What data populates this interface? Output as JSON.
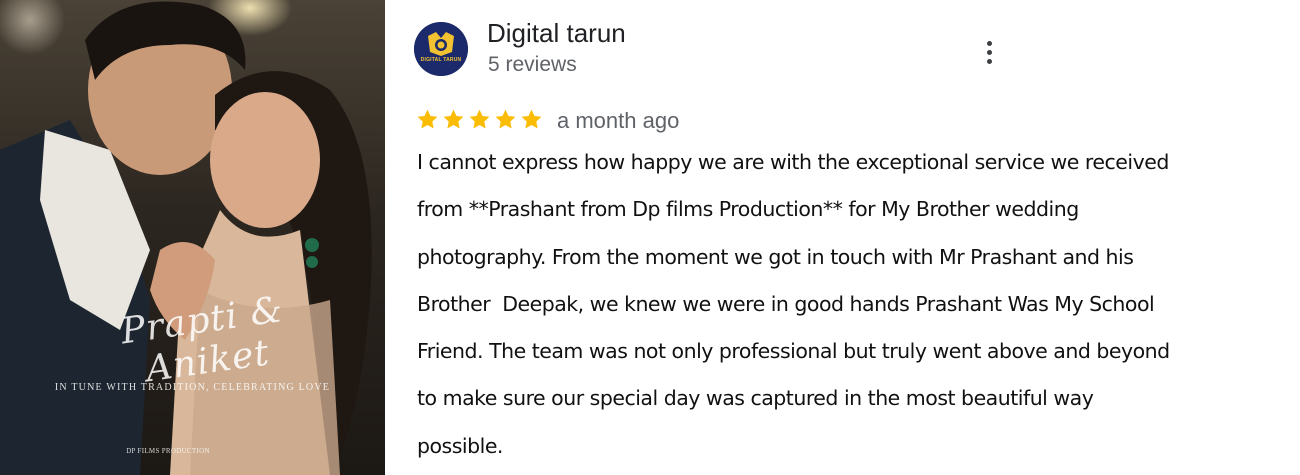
{
  "photo": {
    "title": "Prapti & Aniket",
    "tagline": "IN TUNE WITH TRADITION, CELEBRATING LOVE",
    "credit": "DP FILMS PRODUCTION"
  },
  "reviewer": {
    "avatar_text": "DIGITAL TARUN",
    "name": "Digital tarun",
    "review_count": "5 reviews",
    "more_icon": "more-vertical-icon"
  },
  "review": {
    "rating": 5,
    "rating_max": 5,
    "star_color": "#fbbc04",
    "date": "a month ago",
    "lines": [
      "I cannot express how happy we are with the exceptional service we received",
      "from **Prashant from Dp films Production** for My Brother wedding",
      "photography. From the moment we got in touch with Mr Prashant and his",
      "Brother  Deepak, we knew we were in good hands Prashant Was My School",
      "Friend. The team was not only professional but truly went above and beyond",
      "to make sure our special day was captured in the most beautiful way",
      "possible."
    ]
  }
}
